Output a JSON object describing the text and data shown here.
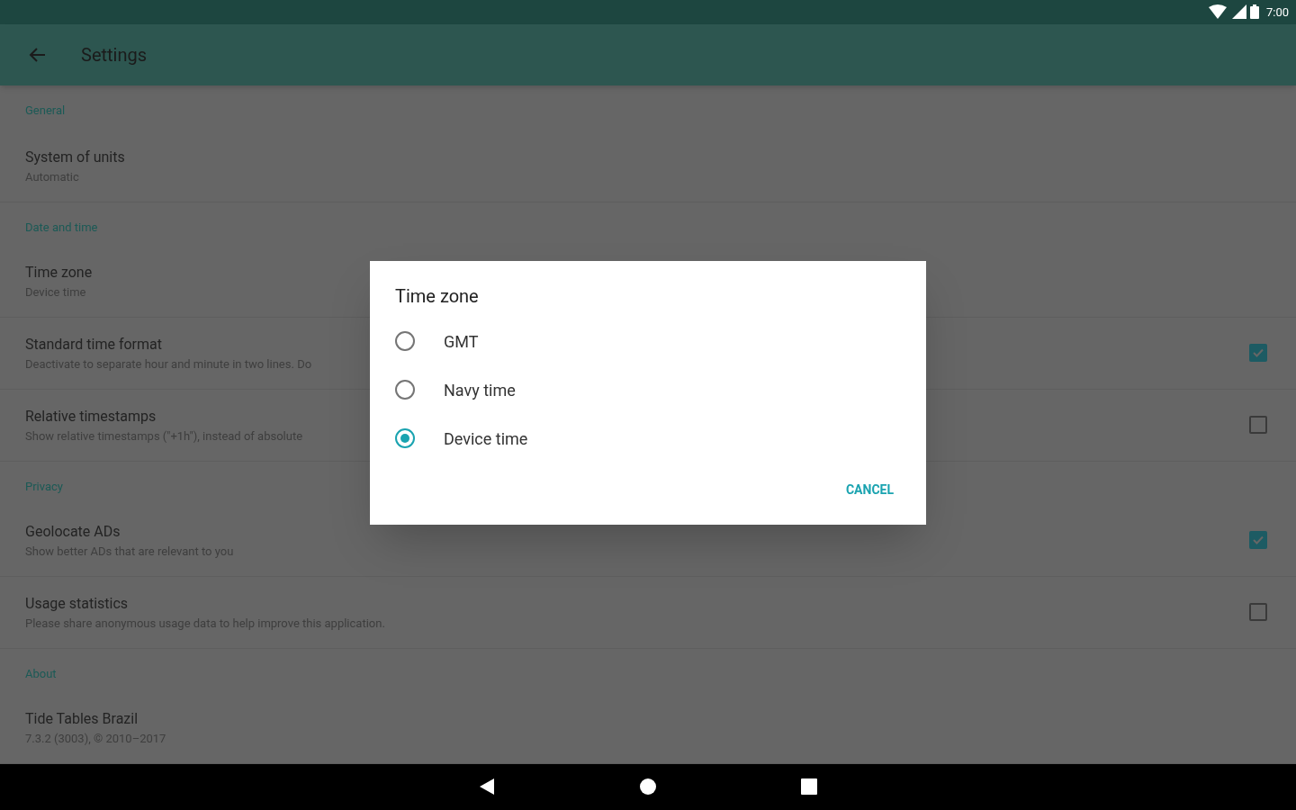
{
  "status_bar": {
    "time": "7:00"
  },
  "app_bar": {
    "title": "Settings"
  },
  "sections": [
    {
      "header": "General",
      "items": [
        {
          "kind": "plain",
          "title": "System of units",
          "subtitle": "Automatic"
        }
      ]
    },
    {
      "header": "Date and time",
      "items": [
        {
          "kind": "plain",
          "title": "Time zone",
          "subtitle": "Device time"
        },
        {
          "kind": "checkbox",
          "title": "Standard time format",
          "subtitle": "Deactivate to separate hour and minute in two lines. Do",
          "checked": true
        },
        {
          "kind": "checkbox",
          "title": "Relative timestamps",
          "subtitle": "Show relative timestamps (\"+1h\"), instead of absolute",
          "checked": false
        }
      ]
    },
    {
      "header": "Privacy",
      "items": [
        {
          "kind": "checkbox",
          "title": "Geolocate ADs",
          "subtitle": "Show better ADs that are relevant to you",
          "checked": true
        },
        {
          "kind": "checkbox",
          "title": "Usage statistics",
          "subtitle": "Please share anonymous usage data to help improve this application.",
          "checked": false
        }
      ]
    },
    {
      "header": "About",
      "items": [
        {
          "kind": "plain",
          "title": "Tide Tables Brazil",
          "subtitle": "7.3.2 (3003), © 2010–2017"
        }
      ]
    }
  ],
  "dialog": {
    "title": "Time zone",
    "options": [
      {
        "label": "GMT",
        "selected": false
      },
      {
        "label": "Navy time",
        "selected": false
      },
      {
        "label": "Device time",
        "selected": true
      }
    ],
    "button": "CANCEL"
  }
}
